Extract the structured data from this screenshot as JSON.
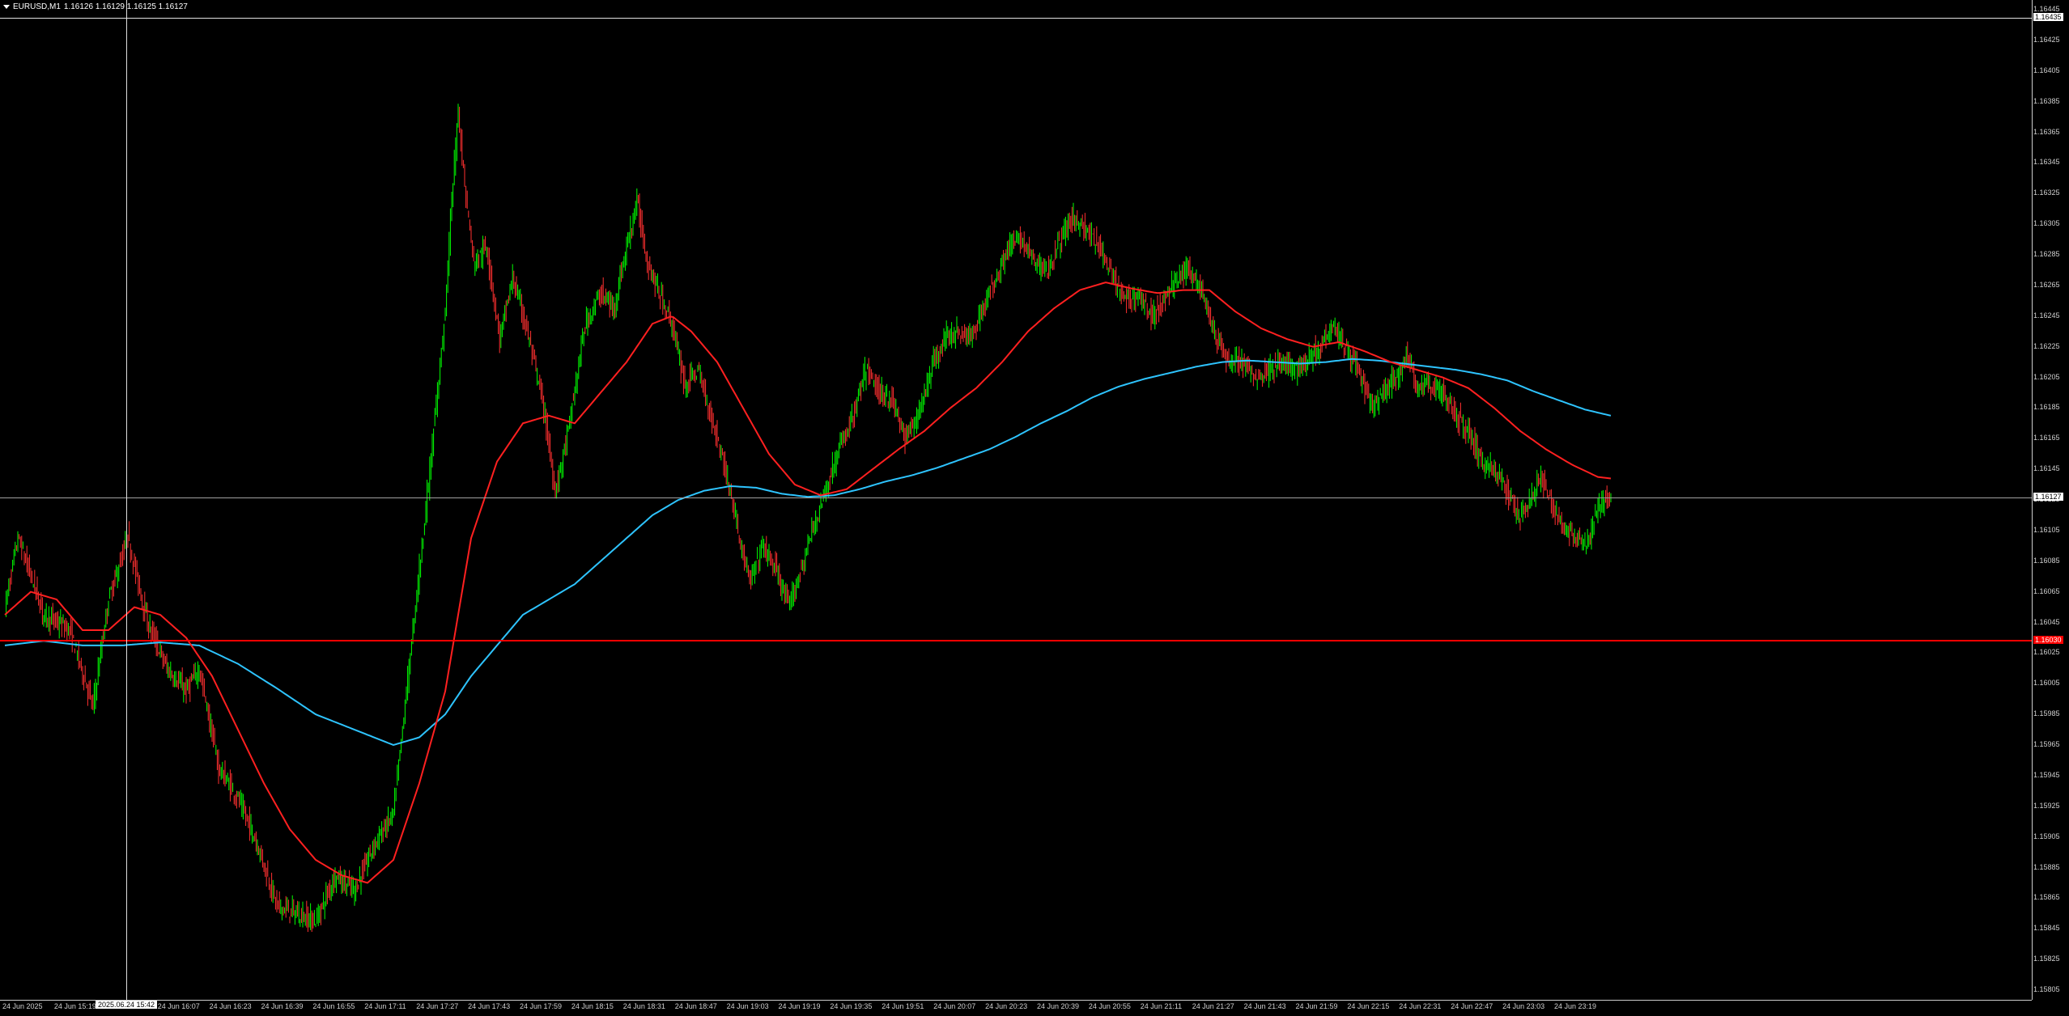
{
  "header": {
    "symbol": "EURUSD,M1",
    "ohlc": "1.16126 1.16129 1.16125 1.16127",
    "menu_icon": "triangle-down-icon"
  },
  "colors": {
    "bull": "#00ff00",
    "bear": "#ff3030",
    "ma_fast": "#ff2020",
    "ma_slow": "#2ec4ff",
    "grid_line": "#a0a0a0",
    "hline": "#ff0000"
  },
  "price_axis": {
    "labels": [
      "1.16445",
      "1.16425",
      "1.16405",
      "1.16385",
      "1.16365",
      "1.16345",
      "1.16325",
      "1.16305",
      "1.16285",
      "1.16265",
      "1.16245",
      "1.16225",
      "1.16205",
      "1.16185",
      "1.16165",
      "1.16145",
      "1.16125",
      "1.16105",
      "1.16085",
      "1.16065",
      "1.16045",
      "1.16025",
      "1.16005",
      "1.15985",
      "1.15965",
      "1.15945",
      "1.15925",
      "1.15905",
      "1.15885",
      "1.15865",
      "1.15845",
      "1.15825",
      "1.15805"
    ]
  },
  "time_axis": {
    "labels": [
      "24 Jun 2025",
      "24 Jun 15:19",
      "24 Jun 15:51",
      "24 Jun 16:07",
      "24 Jun 16:23",
      "24 Jun 16:39",
      "24 Jun 16:55",
      "24 Jun 17:11",
      "24 Jun 17:27",
      "24 Jun 17:43",
      "24 Jun 17:59",
      "24 Jun 18:15",
      "24 Jun 18:31",
      "24 Jun 18:47",
      "24 Jun 19:03",
      "24 Jun 19:19",
      "24 Jun 19:35",
      "24 Jun 19:51",
      "24 Jun 20:07",
      "24 Jun 20:23",
      "24 Jun 20:39",
      "24 Jun 20:55",
      "24 Jun 21:11",
      "24 Jun 21:27",
      "24 Jun 21:43",
      "24 Jun 21:59",
      "24 Jun 22:15",
      "24 Jun 22:31",
      "24 Jun 22:47",
      "24 Jun 23:03",
      "24 Jun 23:19"
    ]
  },
  "crosshair": {
    "price_label": "1.16435",
    "time_label": "2025.06.24 15:42"
  },
  "current_price_tag": "1.16127",
  "hline_tag": "1.16030",
  "series_knots": {
    "price": [
      [
        0,
        1.16055
      ],
      [
        10,
        1.161
      ],
      [
        30,
        1.1605
      ],
      [
        50,
        1.1604
      ],
      [
        68,
        1.1599
      ],
      [
        80,
        1.1606
      ],
      [
        95,
        1.161
      ],
      [
        110,
        1.16045
      ],
      [
        125,
        1.16015
      ],
      [
        140,
        1.16
      ],
      [
        150,
        1.16015
      ],
      [
        165,
        1.1595
      ],
      [
        180,
        1.1593
      ],
      [
        195,
        1.159
      ],
      [
        210,
        1.1586
      ],
      [
        225,
        1.15855
      ],
      [
        240,
        1.1585
      ],
      [
        255,
        1.1588
      ],
      [
        270,
        1.1587
      ],
      [
        285,
        1.159
      ],
      [
        300,
        1.1592
      ],
      [
        310,
        1.16
      ],
      [
        320,
        1.1608
      ],
      [
        330,
        1.1616
      ],
      [
        340,
        1.1625
      ],
      [
        345,
        1.1632
      ],
      [
        350,
        1.1638
      ],
      [
        355,
        1.1633
      ],
      [
        362,
        1.1628
      ],
      [
        372,
        1.1629
      ],
      [
        382,
        1.1623
      ],
      [
        392,
        1.1627
      ],
      [
        402,
        1.1624
      ],
      [
        415,
        1.1619
      ],
      [
        425,
        1.1613
      ],
      [
        435,
        1.1617
      ],
      [
        448,
        1.1624
      ],
      [
        460,
        1.1626
      ],
      [
        470,
        1.1625
      ],
      [
        480,
        1.1629
      ],
      [
        488,
        1.1632
      ],
      [
        496,
        1.1628
      ],
      [
        505,
        1.1626
      ],
      [
        515,
        1.1624
      ],
      [
        525,
        1.162
      ],
      [
        535,
        1.1621
      ],
      [
        545,
        1.1618
      ],
      [
        555,
        1.1615
      ],
      [
        565,
        1.1611
      ],
      [
        575,
        1.1607
      ],
      [
        585,
        1.16095
      ],
      [
        595,
        1.1608
      ],
      [
        605,
        1.16055
      ],
      [
        615,
        1.1608
      ],
      [
        625,
        1.1611
      ],
      [
        635,
        1.16135
      ],
      [
        645,
        1.1616
      ],
      [
        655,
        1.1618
      ],
      [
        665,
        1.1621
      ],
      [
        675,
        1.16195
      ],
      [
        685,
        1.1619
      ],
      [
        695,
        1.16165
      ],
      [
        705,
        1.1618
      ],
      [
        715,
        1.1621
      ],
      [
        725,
        1.1623
      ],
      [
        735,
        1.16235
      ],
      [
        745,
        1.1623
      ],
      [
        755,
        1.1625
      ],
      [
        765,
        1.1627
      ],
      [
        775,
        1.1629
      ],
      [
        785,
        1.16295
      ],
      [
        795,
        1.1628
      ],
      [
        805,
        1.16275
      ],
      [
        815,
        1.16295
      ],
      [
        825,
        1.1631
      ],
      [
        835,
        1.163
      ],
      [
        845,
        1.1629
      ],
      [
        855,
        1.1627
      ],
      [
        865,
        1.16255
      ],
      [
        875,
        1.1626
      ],
      [
        885,
        1.16245
      ],
      [
        895,
        1.16255
      ],
      [
        905,
        1.1627
      ],
      [
        915,
        1.16275
      ],
      [
        925,
        1.1626
      ],
      [
        935,
        1.1623
      ],
      [
        945,
        1.16215
      ],
      [
        955,
        1.16215
      ],
      [
        965,
        1.16205
      ],
      [
        975,
        1.1621
      ],
      [
        985,
        1.16215
      ],
      [
        995,
        1.1621
      ],
      [
        1005,
        1.16215
      ],
      [
        1015,
        1.16225
      ],
      [
        1025,
        1.1624
      ],
      [
        1035,
        1.16225
      ],
      [
        1045,
        1.1621
      ],
      [
        1055,
        1.16185
      ],
      [
        1065,
        1.16195
      ],
      [
        1075,
        1.16205
      ],
      [
        1082,
        1.1622
      ],
      [
        1090,
        1.162
      ],
      [
        1100,
        1.162
      ],
      [
        1110,
        1.16195
      ],
      [
        1120,
        1.1618
      ],
      [
        1130,
        1.1617
      ],
      [
        1140,
        1.1615
      ],
      [
        1150,
        1.16145
      ],
      [
        1160,
        1.1613
      ],
      [
        1170,
        1.16115
      ],
      [
        1178,
        1.16125
      ],
      [
        1186,
        1.1614
      ],
      [
        1195,
        1.1612
      ],
      [
        1205,
        1.16105
      ],
      [
        1215,
        1.161
      ],
      [
        1222,
        1.16095
      ],
      [
        1230,
        1.1612
      ],
      [
        1240,
        1.16127
      ]
    ],
    "ma_fast": [
      [
        0,
        1.1605
      ],
      [
        20,
        1.16065
      ],
      [
        40,
        1.1606
      ],
      [
        60,
        1.1604
      ],
      [
        80,
        1.1604
      ],
      [
        100,
        1.16055
      ],
      [
        120,
        1.1605
      ],
      [
        140,
        1.16035
      ],
      [
        160,
        1.1601
      ],
      [
        180,
        1.15975
      ],
      [
        200,
        1.1594
      ],
      [
        220,
        1.1591
      ],
      [
        240,
        1.1589
      ],
      [
        260,
        1.1588
      ],
      [
        280,
        1.15875
      ],
      [
        300,
        1.1589
      ],
      [
        320,
        1.1594
      ],
      [
        340,
        1.16
      ],
      [
        360,
        1.161
      ],
      [
        380,
        1.1615
      ],
      [
        400,
        1.16175
      ],
      [
        420,
        1.1618
      ],
      [
        440,
        1.16175
      ],
      [
        460,
        1.16195
      ],
      [
        480,
        1.16215
      ],
      [
        500,
        1.1624
      ],
      [
        515,
        1.16245
      ],
      [
        530,
        1.16235
      ],
      [
        550,
        1.16215
      ],
      [
        570,
        1.16185
      ],
      [
        590,
        1.16155
      ],
      [
        610,
        1.16135
      ],
      [
        630,
        1.16128
      ],
      [
        650,
        1.16132
      ],
      [
        670,
        1.16145
      ],
      [
        690,
        1.16158
      ],
      [
        710,
        1.1617
      ],
      [
        730,
        1.16185
      ],
      [
        750,
        1.16198
      ],
      [
        770,
        1.16215
      ],
      [
        790,
        1.16235
      ],
      [
        810,
        1.1625
      ],
      [
        830,
        1.16262
      ],
      [
        850,
        1.16267
      ],
      [
        870,
        1.16263
      ],
      [
        890,
        1.1626
      ],
      [
        910,
        1.16262
      ],
      [
        930,
        1.16262
      ],
      [
        950,
        1.16248
      ],
      [
        970,
        1.16237
      ],
      [
        990,
        1.1623
      ],
      [
        1010,
        1.16225
      ],
      [
        1030,
        1.16228
      ],
      [
        1050,
        1.16222
      ],
      [
        1070,
        1.16215
      ],
      [
        1090,
        1.1621
      ],
      [
        1110,
        1.16205
      ],
      [
        1130,
        1.16198
      ],
      [
        1150,
        1.16185
      ],
      [
        1170,
        1.1617
      ],
      [
        1190,
        1.16158
      ],
      [
        1210,
        1.16148
      ],
      [
        1230,
        1.1614
      ],
      [
        1240,
        1.16139
      ]
    ],
    "ma_slow": [
      [
        0,
        1.1603
      ],
      [
        30,
        1.16033
      ],
      [
        60,
        1.1603
      ],
      [
        90,
        1.1603
      ],
      [
        120,
        1.16032
      ],
      [
        150,
        1.1603
      ],
      [
        180,
        1.16018
      ],
      [
        210,
        1.16002
      ],
      [
        240,
        1.15985
      ],
      [
        270,
        1.15975
      ],
      [
        300,
        1.15965
      ],
      [
        320,
        1.1597
      ],
      [
        340,
        1.15985
      ],
      [
        360,
        1.1601
      ],
      [
        380,
        1.1603
      ],
      [
        400,
        1.1605
      ],
      [
        420,
        1.1606
      ],
      [
        440,
        1.1607
      ],
      [
        460,
        1.16085
      ],
      [
        480,
        1.161
      ],
      [
        500,
        1.16115
      ],
      [
        520,
        1.16125
      ],
      [
        540,
        1.16131
      ],
      [
        560,
        1.16134
      ],
      [
        580,
        1.16133
      ],
      [
        600,
        1.16129
      ],
      [
        620,
        1.16127
      ],
      [
        640,
        1.16128
      ],
      [
        660,
        1.16132
      ],
      [
        680,
        1.16137
      ],
      [
        700,
        1.16141
      ],
      [
        720,
        1.16146
      ],
      [
        740,
        1.16152
      ],
      [
        760,
        1.16158
      ],
      [
        780,
        1.16166
      ],
      [
        800,
        1.16175
      ],
      [
        820,
        1.16183
      ],
      [
        840,
        1.16192
      ],
      [
        860,
        1.16199
      ],
      [
        880,
        1.16204
      ],
      [
        900,
        1.16208
      ],
      [
        920,
        1.16212
      ],
      [
        940,
        1.16215
      ],
      [
        960,
        1.16216
      ],
      [
        980,
        1.16215
      ],
      [
        1000,
        1.16214
      ],
      [
        1020,
        1.16215
      ],
      [
        1040,
        1.16217
      ],
      [
        1060,
        1.16216
      ],
      [
        1080,
        1.16214
      ],
      [
        1100,
        1.16212
      ],
      [
        1120,
        1.1621
      ],
      [
        1140,
        1.16207
      ],
      [
        1160,
        1.16203
      ],
      [
        1180,
        1.16196
      ],
      [
        1200,
        1.1619
      ],
      [
        1220,
        1.16184
      ],
      [
        1240,
        1.1618
      ]
    ]
  }
}
